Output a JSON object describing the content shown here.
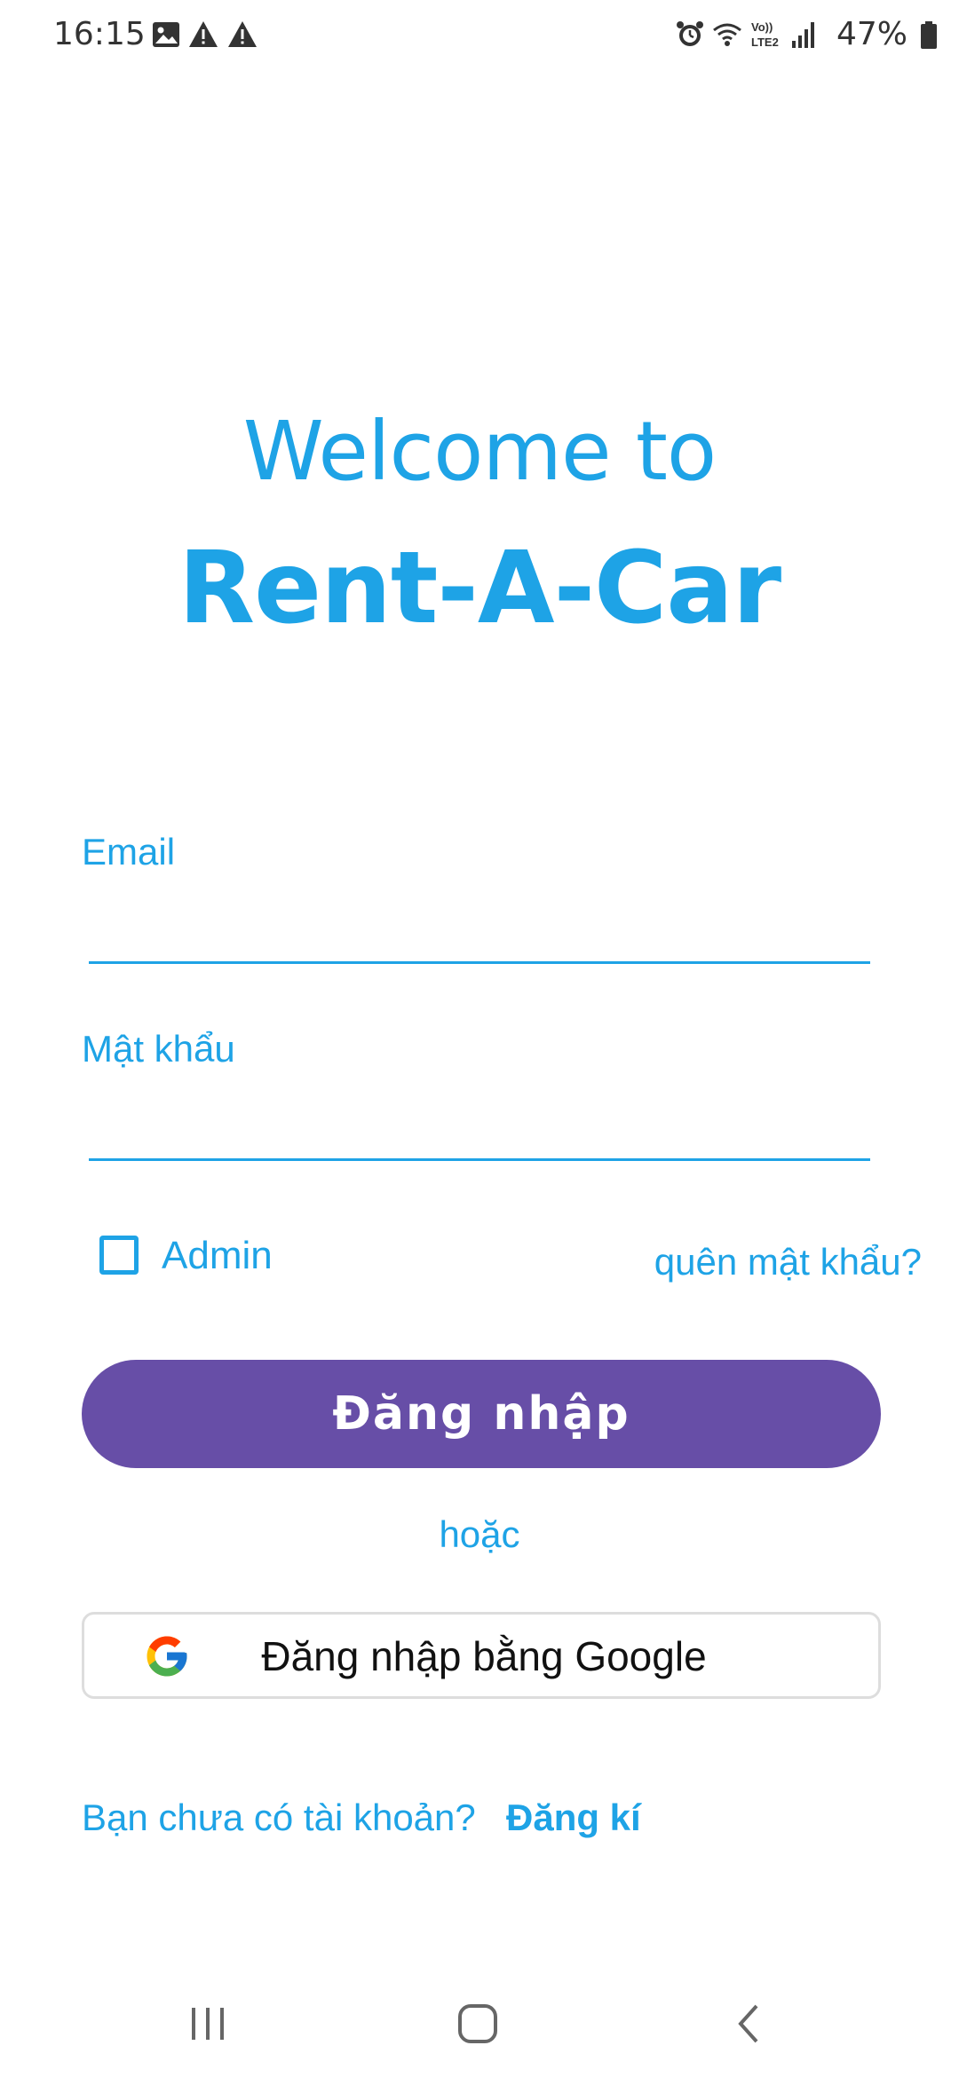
{
  "status_bar": {
    "time": "16:15",
    "battery_percent": "47%",
    "icons": [
      "image-icon",
      "warning-icon",
      "warning-icon",
      "alarm-icon",
      "wifi-icon",
      "volte-icon",
      "signal-icon",
      "battery-icon"
    ],
    "network_label": "Vo)) LTE2"
  },
  "header": {
    "line1": "Welcome to",
    "line2": "Rent-A-Car"
  },
  "form": {
    "email_label": "Email",
    "email_value": "",
    "password_label": "Mật khẩu",
    "password_value": "",
    "admin_label": "Admin",
    "admin_checked": false,
    "forgot_label": "quên mật khẩu?"
  },
  "actions": {
    "login_label": "Đăng  nhập",
    "or_label": "hoặc",
    "google_label": "Đăng nhập bằng Google"
  },
  "register": {
    "question": "Bạn chưa có tài khoản?",
    "link": "Đăng kí"
  },
  "colors": {
    "accent": "#1ea3e6",
    "primary_button": "#674ea7"
  }
}
